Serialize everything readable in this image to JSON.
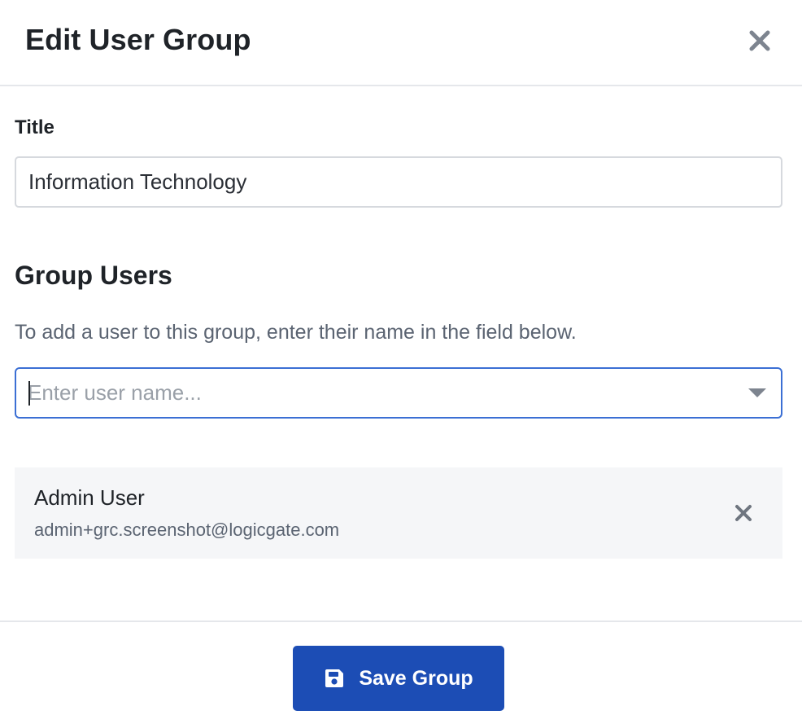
{
  "dialog": {
    "title": "Edit User Group"
  },
  "title_field": {
    "label": "Title",
    "value": "Information Technology"
  },
  "group_users": {
    "heading": "Group Users",
    "help_text": "To add a user to this group, enter their name in the field below.",
    "search_placeholder": "Enter user name...",
    "users": [
      {
        "name": "Admin User",
        "email": "admin+grc.screenshot@logicgate.com"
      }
    ]
  },
  "footer": {
    "save_label": "Save Group"
  },
  "icons": {
    "close": "close-icon",
    "dropdown": "chevron-down-icon",
    "remove_user": "close-icon",
    "save": "floppy-disk-icon"
  },
  "colors": {
    "primary_button": "#1c4db5",
    "focus_border": "#3b6fd4",
    "icon_gray": "#7d848f",
    "card_background": "#f5f6f8"
  }
}
